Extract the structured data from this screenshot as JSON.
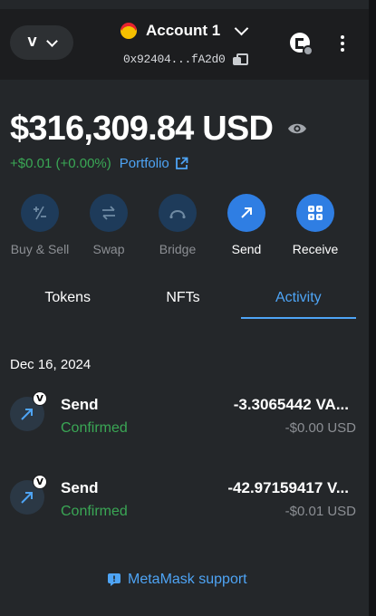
{
  "header": {
    "network_label": "V",
    "account_name": "Account 1",
    "address": "0x92404...fA2d0"
  },
  "balance": {
    "amount": "$316,309.84 USD",
    "change": "+$0.01 (+0.00%)",
    "portfolio_label": "Portfolio"
  },
  "actions": [
    {
      "label": "Buy & Sell",
      "icon": "plus-minus-icon",
      "active": false
    },
    {
      "label": "Swap",
      "icon": "swap-arrows-icon",
      "active": false
    },
    {
      "label": "Bridge",
      "icon": "bridge-icon",
      "active": false
    },
    {
      "label": "Send",
      "icon": "send-arrow-icon",
      "active": true
    },
    {
      "label": "Receive",
      "icon": "receive-qr-icon",
      "active": true
    }
  ],
  "tabs": [
    {
      "label": "Tokens",
      "active": false
    },
    {
      "label": "NFTs",
      "active": false
    },
    {
      "label": "Activity",
      "active": true
    }
  ],
  "activity": {
    "date": "Dec 16, 2024",
    "transactions": [
      {
        "type": "Send",
        "status": "Confirmed",
        "amount": "-3.3065442 VA...",
        "fiat": "-$0.00 USD",
        "badge": "V"
      },
      {
        "type": "Send",
        "status": "Confirmed",
        "amount": "-42.97159417 V...",
        "fiat": "-$0.01 USD",
        "badge": "V"
      }
    ]
  },
  "footer": {
    "support_label": "MetaMask support"
  },
  "colors": {
    "accent": "#4ea4f5",
    "positive": "#3aa755",
    "action_active": "#2f7ee3",
    "action_inactive": "#1e3b5a"
  }
}
